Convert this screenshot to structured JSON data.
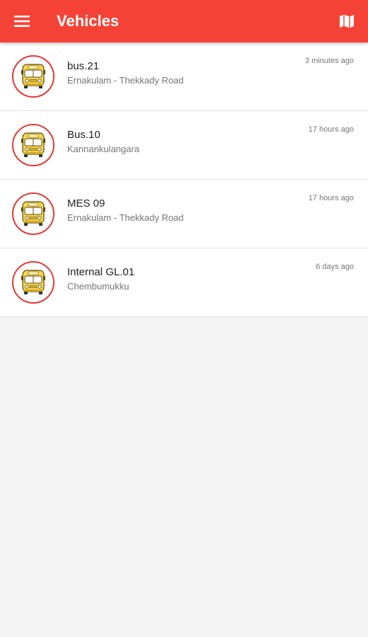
{
  "toolbar": {
    "title": "Vehicles",
    "menu_icon": "hamburger-menu-icon",
    "map_icon": "map-icon",
    "background_color": "#f44336"
  },
  "vehicles": [
    {
      "name": "bus.21",
      "route": "Ernakulam - Thekkady Road",
      "time": "3 minutes ago",
      "icon": "school-bus-icon"
    },
    {
      "name": "Bus.10",
      "route": "Kannankulangara",
      "time": "17 hours ago",
      "icon": "school-bus-icon"
    },
    {
      "name": "MES 09",
      "route": "Ernakulam - Thekkady Road",
      "time": "17 hours ago",
      "icon": "school-bus-icon"
    },
    {
      "name": "Internal GL.01",
      "route": "Chembumukku",
      "time": "6 days ago",
      "icon": "school-bus-icon"
    }
  ],
  "colors": {
    "avatar_ring": "#e53935",
    "bus_body": "#f6d54a"
  }
}
